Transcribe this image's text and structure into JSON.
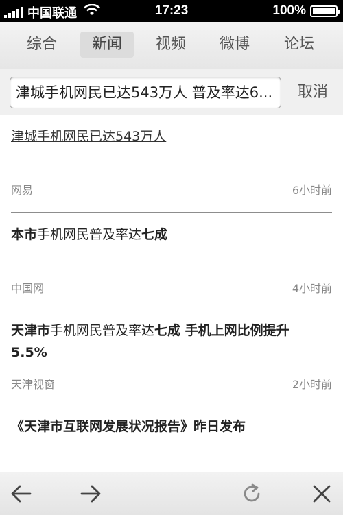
{
  "status_bar": {
    "carrier": "中国联通",
    "time": "17:23",
    "battery": "100%",
    "battery_level": 1.0
  },
  "tabs": [
    {
      "label": "综合",
      "active": false
    },
    {
      "label": "新闻",
      "active": true
    },
    {
      "label": "视频",
      "active": false
    },
    {
      "label": "微博",
      "active": false
    },
    {
      "label": "论坛",
      "active": false
    }
  ],
  "search": {
    "query": "津城手机网民已达543万人 普及率达6...",
    "cancel_label": "取消"
  },
  "results": [
    {
      "title": "津城手机网民已达543万人",
      "source": "网易",
      "time": "6小时前"
    },
    {
      "title_parts": [
        "本市",
        "手机网民普及率达",
        "七成"
      ],
      "source": "中国网",
      "time": "4小时前"
    },
    {
      "title_line1_parts": [
        "天津市",
        "手机网民普及率达",
        "七成 手机上网比例提升"
      ],
      "title_line2": "5.5%",
      "source": "天津视窗",
      "time": "2小时前"
    },
    {
      "title": "《天津市互联网发展状况报告》昨日发布"
    }
  ],
  "bottom_nav": {
    "icons": [
      "back-arrow-icon",
      "forward-arrow-icon",
      "refresh-icon",
      "close-icon"
    ]
  }
}
